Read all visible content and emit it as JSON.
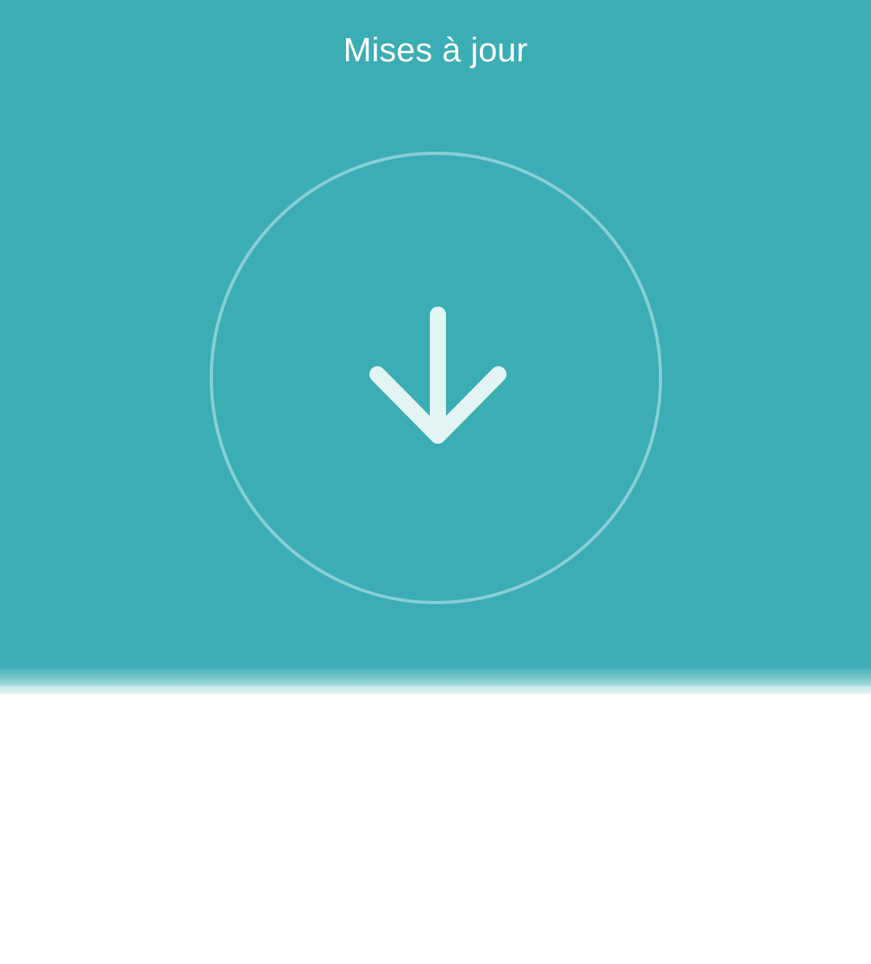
{
  "header": {
    "title": "Mises à jour",
    "background_color": "#3badb4",
    "icon": "download-arrow-icon",
    "ring_color": "#a8dadd",
    "icon_color": "#e3f4f4"
  },
  "content": {
    "background_color": "#ffffff"
  }
}
